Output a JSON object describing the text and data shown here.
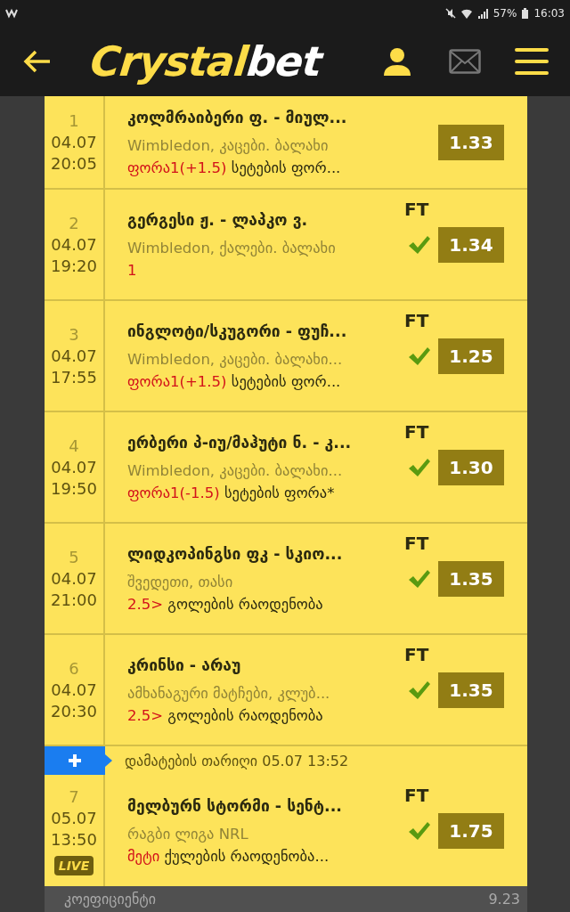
{
  "status_bar": {
    "time": "16:03",
    "battery": "57%"
  },
  "header": {
    "logo": {
      "primary": "Crystal",
      "accent": "bet"
    }
  },
  "rows": [
    {
      "number": "1",
      "date": "04.07",
      "time": "20:05",
      "title": "კოლმრაიბერი ფ. - მიულ...",
      "league": "Wimbledon, კაცები. ბალახი",
      "pick": "ფორა1(+1.5)",
      "market": "სეტების ფორ...",
      "odds": "1.33",
      "won": false,
      "live": false
    },
    {
      "number": "2",
      "date": "04.07",
      "time": "19:20",
      "title": "გერგესი ჟ. - ლაპკო ვ.",
      "status": "FT",
      "league": "Wimbledon, ქალები. ბალახი",
      "pick": "1",
      "odds": "1.34",
      "won": true,
      "live": false
    },
    {
      "number": "3",
      "date": "04.07",
      "time": "17:55",
      "title": "ინგლოტი/სკუგორი - ფუჩ...",
      "status": "FT",
      "league": "Wimbledon, კაცები. ბალახი...",
      "pick": "ფორა1(+1.5)",
      "market": "სეტების ფორ...",
      "odds": "1.25",
      "won": true,
      "live": false
    },
    {
      "number": "4",
      "date": "04.07",
      "time": "19:50",
      "title": "ერბერი პ-იუ/მაჰუტი ნ. - კ...",
      "status": "FT",
      "league": "Wimbledon, კაცები. ბალახი...",
      "pick": "ფორა1(-1.5)",
      "market": "სეტების ფორა*",
      "odds": "1.30",
      "won": true,
      "live": false
    },
    {
      "number": "5",
      "date": "04.07",
      "time": "21:00",
      "title": "ლიდკოპინგსი ფკ - სკიო...",
      "status": "FT",
      "league": "შვედეთი, თასი",
      "pick": "2.5>",
      "market": "გოლების რაოდენობა",
      "odds": "1.35",
      "won": true,
      "live": false
    },
    {
      "number": "6",
      "date": "04.07",
      "time": "20:30",
      "title": "კრინსი - არაუ",
      "status": "FT",
      "league": "ამხანაგური მატჩები, კლუბ...",
      "pick": "2.5>",
      "market": "გოლების რაოდენობა",
      "odds": "1.35",
      "won": true,
      "live": false
    },
    {
      "number": "7",
      "date": "05.07",
      "time": "13:50",
      "title": "მელბურნ სტორმი - სენტ...",
      "status": "FT",
      "league": "რაგბი ლიგა NRL",
      "pick": "მეტი",
      "market": "ქულების რაოდენობა...",
      "odds": "1.75",
      "won": true,
      "live": true,
      "live_label": "LIVE",
      "added_note": "დამატების თარიღი 05.07 13:52"
    }
  ],
  "footer": {
    "label": "კოეფიციენტი",
    "value": "9.23"
  }
}
